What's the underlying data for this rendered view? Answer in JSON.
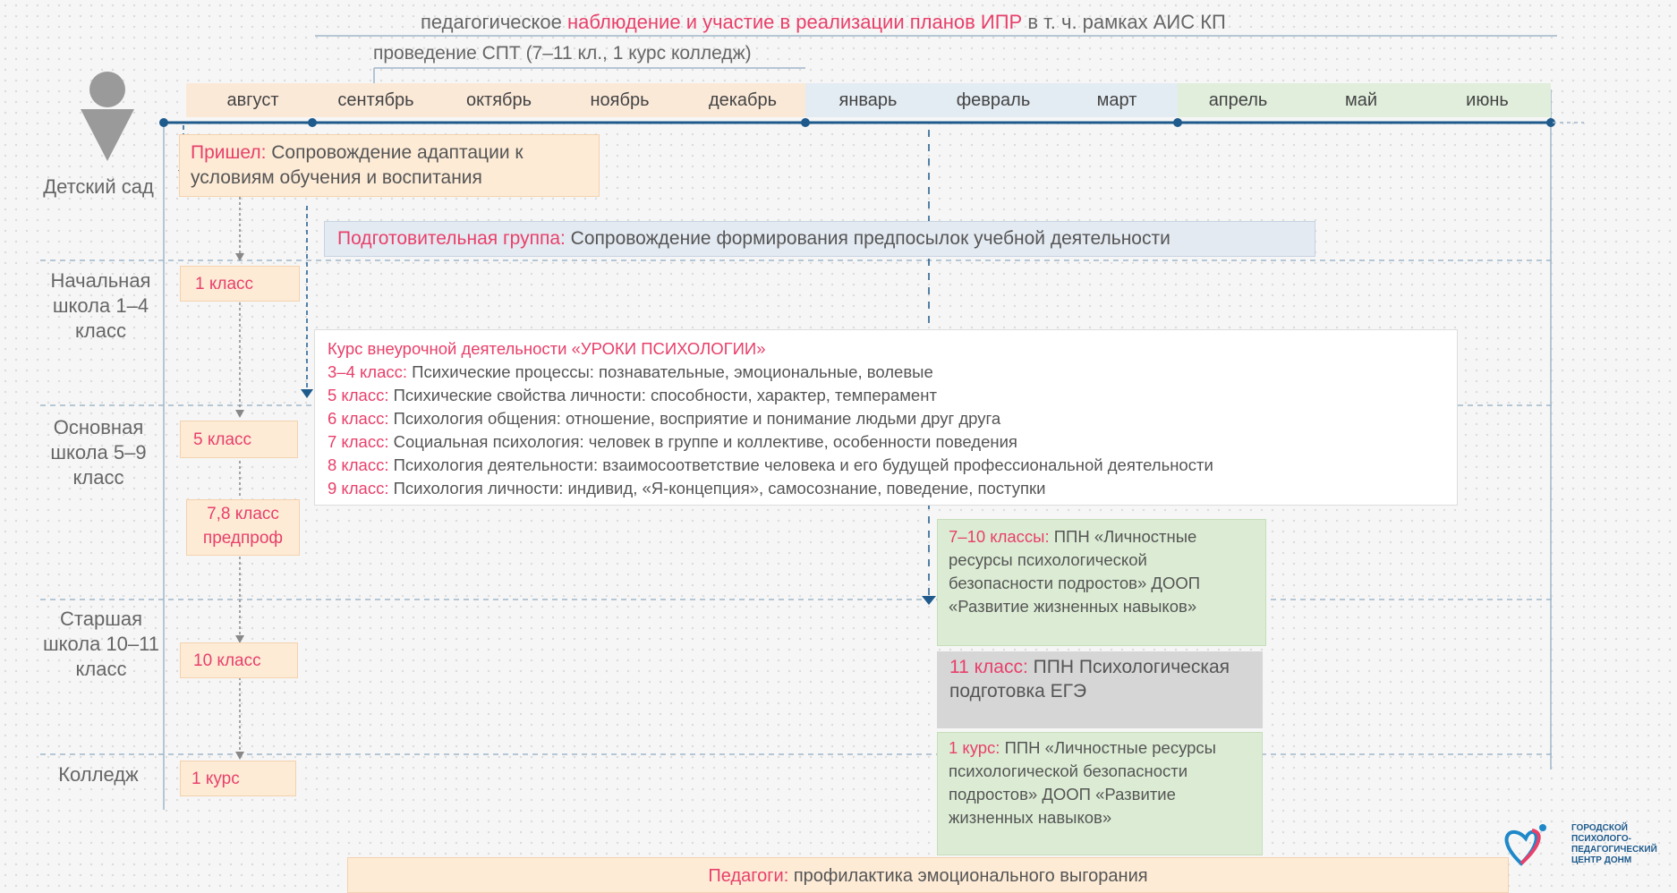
{
  "header": {
    "line1_pre": "педагогическое ",
    "line1_hl": "наблюдение и участие в реализации планов ИПР",
    "line1_post": " в т. ч. рамках АИС КП",
    "line2": "проведение СПТ (7–11 кл., 1 курс колледж)"
  },
  "months": [
    "август",
    "сентябрь",
    "октябрь",
    "ноябрь",
    "декабрь",
    "январь",
    "февраль",
    "март",
    "апрель",
    "май",
    "июнь"
  ],
  "levels": {
    "kindergarten": "Детский сад",
    "primary": "Начальная школа 1–4 класс",
    "basic": "Основная школа 5–9 класс",
    "senior": "Старшая школа 10–11 класс",
    "college": "Колледж"
  },
  "stages": {
    "came": {
      "hl": "Пришел:",
      "text": " Сопровождение адаптации к условиям обучения и воспитания"
    },
    "grade1": "1 класс",
    "grade5": "5 класс",
    "grade78": "7,8 класс предпроф",
    "grade10": "10 класс",
    "course1": "1 курс"
  },
  "prep_group": {
    "hl": "Подготовительная группа:",
    "text": " Сопровождение формирования предпосылок учебной деятельности"
  },
  "course_box": {
    "title": "Курс внеурочной деятельности «УРОКИ ПСИХОЛОГИИ»",
    "rows": [
      {
        "hl": "3–4 класс:",
        "text": " Психические процессы: познавательные, эмоциональные, волевые"
      },
      {
        "hl": "5 класс:",
        "text": " Психические свойства личности: способности, характер, темперамент"
      },
      {
        "hl": "6 класс:",
        "text": " Психология общения: отношение, восприятие и понимание людьми друг друга"
      },
      {
        "hl": "7 класс:",
        "text": " Социальная психология: человек в группе и коллективе, особенности поведения"
      },
      {
        "hl": "8 класс:",
        "text": " Психология деятельности: взаимосоответствие человека и его будущей профессиональной деятельности"
      },
      {
        "hl": "9 класс:",
        "text": " Психология личности: индивид, «Я-концепция», самосознание, поведение, поступки"
      }
    ]
  },
  "ppn_7_10": {
    "hl": "7–10 классы:",
    "text": " ППН «Личностные ресурсы психологической безопасности подростов» ДООП «Развитие жизненных навыков»"
  },
  "ppn_11": {
    "hl": "11 класс:",
    "text": " ППН Психологическая подготовка ЕГЭ"
  },
  "ppn_course1": {
    "hl": "1 курс:",
    "text": " ППН «Личностные ресурсы психологической безопасности подростов» ДООП «Развитие жизненных навыков»"
  },
  "teachers": {
    "hl": "Педагоги:",
    "text": " профилактика эмоционального выгорания"
  },
  "logo": {
    "text": "ГОРОДСКОЙ ПСИХОЛОГО-ПЕДАГОГИЧЕСКИЙ ЦЕНТР ДОНМ"
  },
  "colors": {
    "accent": "#e8406a",
    "peach": "#fdebd6",
    "green": "#dcecd4",
    "blue": "#e4eaf2",
    "line": "#1e5a8c"
  }
}
